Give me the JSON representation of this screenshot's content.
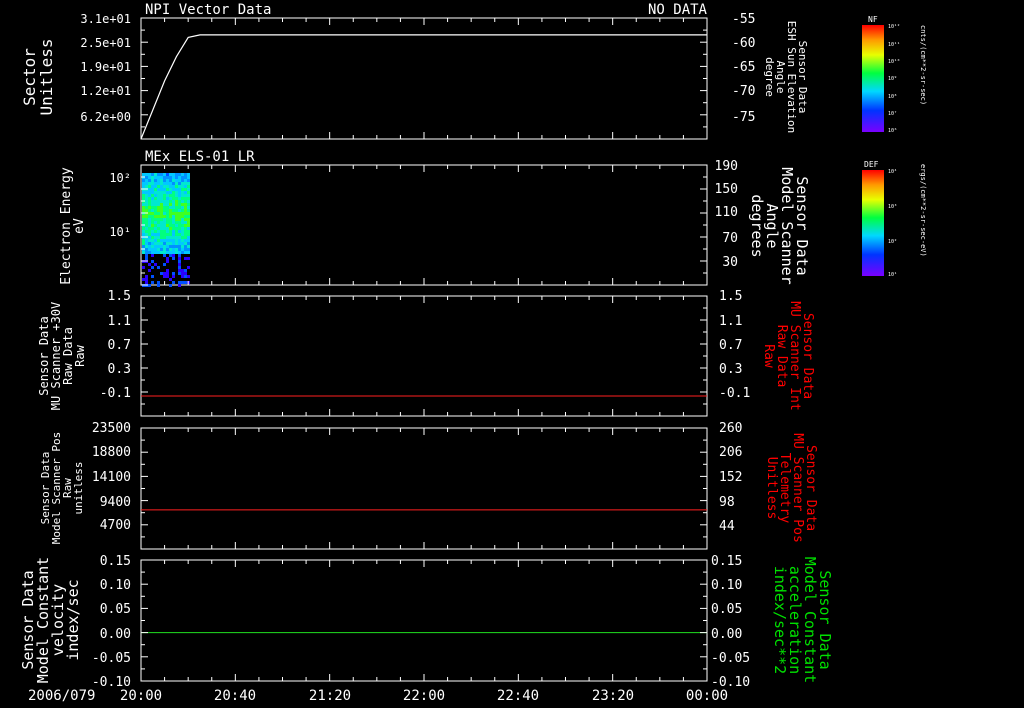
{
  "date_label": "2006/079",
  "time_ticks": [
    "20:00",
    "20:40",
    "21:20",
    "22:00",
    "22:40",
    "23:20",
    "00:00"
  ],
  "colorbars": [
    {
      "label": "NF",
      "unit": "cnts/(cm**2-sr-sec)",
      "tick_labels": [
        "10¹²",
        "10¹¹",
        "10¹⁰",
        "10⁹",
        "10⁸",
        "10⁷",
        "10⁶"
      ]
    },
    {
      "label": "DEF",
      "unit": "ergs/(cm**2-sr-sec-eV)",
      "tick_labels": [
        "10⁴",
        "10³",
        "10²",
        "10¹"
      ]
    }
  ],
  "colors": {
    "background": "#000000",
    "axes": "#ffffff",
    "red_trace": "#ff2020",
    "green_trace": "#20e020",
    "red_label": "#ff0000",
    "green_label": "#00e000"
  },
  "chart_data": [
    {
      "type": "line",
      "title": "NPI Vector Data",
      "status": "NO DATA",
      "left_label": [
        "Sector",
        "Unitless"
      ],
      "right_label": [
        "Sensor Data",
        "ESH Sun Elevation",
        "Angle",
        "degree"
      ],
      "left_ticks": [
        "3.1e+01",
        "2.5e+01",
        "1.9e+01",
        "1.2e+01",
        "6.2e+00"
      ],
      "right_ticks": [
        "-55",
        "-60",
        "-65",
        "-70",
        "-75"
      ],
      "ylim_right": [
        -79,
        -54
      ],
      "series": [
        {
          "x": [
            "20:00",
            "20:05",
            "20:10",
            "20:15",
            "20:20",
            "20:25",
            "24:00"
          ],
          "y": [
            -79,
            -73,
            -67,
            -62,
            -58,
            -57.5,
            -57.5
          ]
        }
      ]
    },
    {
      "type": "heatmap",
      "title": "MEx ELS-01 LR",
      "left_label": [
        "Electron Energy",
        "eV"
      ],
      "right_label": [
        "Sensor Data",
        "Model Scanner",
        "Angle",
        "degrees"
      ],
      "left_ticks": [
        "10²",
        "10¹"
      ],
      "right_ticks": [
        "190",
        "150",
        "110",
        "70",
        "30"
      ],
      "x_range": [
        "20:00",
        "20:20"
      ],
      "energy_range_eV": [
        1,
        150
      ],
      "colorscale": "DEF"
    },
    {
      "type": "line",
      "left_label": [
        "Sensor Data",
        "MU Scanner +30V",
        "Raw Data",
        "Raw"
      ],
      "right_label": [
        "Sensor Data",
        "MU Scanner Int",
        "Raw Data",
        "Raw"
      ],
      "left_ticks": [
        "1.5",
        "1.1",
        "0.7",
        "0.3",
        "-0.1"
      ],
      "right_ticks": [
        "1.5",
        "1.1",
        "0.7",
        "0.3",
        "-0.1"
      ],
      "ylim": [
        -0.3,
        1.5
      ],
      "series": [
        {
          "x": [
            "20:00",
            "24:00"
          ],
          "y": [
            0.0,
            0.0
          ]
        }
      ]
    },
    {
      "type": "line",
      "left_label": [
        "Sensor Data",
        "Model Scanner Pos",
        "Raw",
        "unitless"
      ],
      "right_label": [
        "Sensor Data",
        "MU Scanner Pos",
        "Telemetry",
        "Unitless"
      ],
      "left_ticks": [
        "23500",
        "18800",
        "14100",
        "9400",
        "4700"
      ],
      "right_ticks": [
        "260",
        "206",
        "152",
        "98",
        "44"
      ],
      "ylim": [
        0,
        23500
      ],
      "series": [
        {
          "x": [
            "20:00",
            "24:00"
          ],
          "y": [
            7600,
            7600
          ]
        }
      ]
    },
    {
      "type": "line",
      "left_label": [
        "Sensor Data",
        "Model Constant",
        "velocity",
        "index/sec"
      ],
      "right_label": [
        "Sensor Data",
        "Model Constant",
        "acceleration",
        "index/sec**2"
      ],
      "left_ticks": [
        "0.15",
        "0.10",
        "0.05",
        "0.00",
        "-0.05",
        "-0.10"
      ],
      "right_ticks": [
        "0.15",
        "0.10",
        "0.05",
        "0.00",
        "-0.05",
        "-0.10"
      ],
      "ylim": [
        -0.1,
        0.15
      ],
      "series": [
        {
          "x": [
            "20:00",
            "24:00"
          ],
          "y": [
            0.0,
            0.0
          ]
        }
      ]
    }
  ]
}
